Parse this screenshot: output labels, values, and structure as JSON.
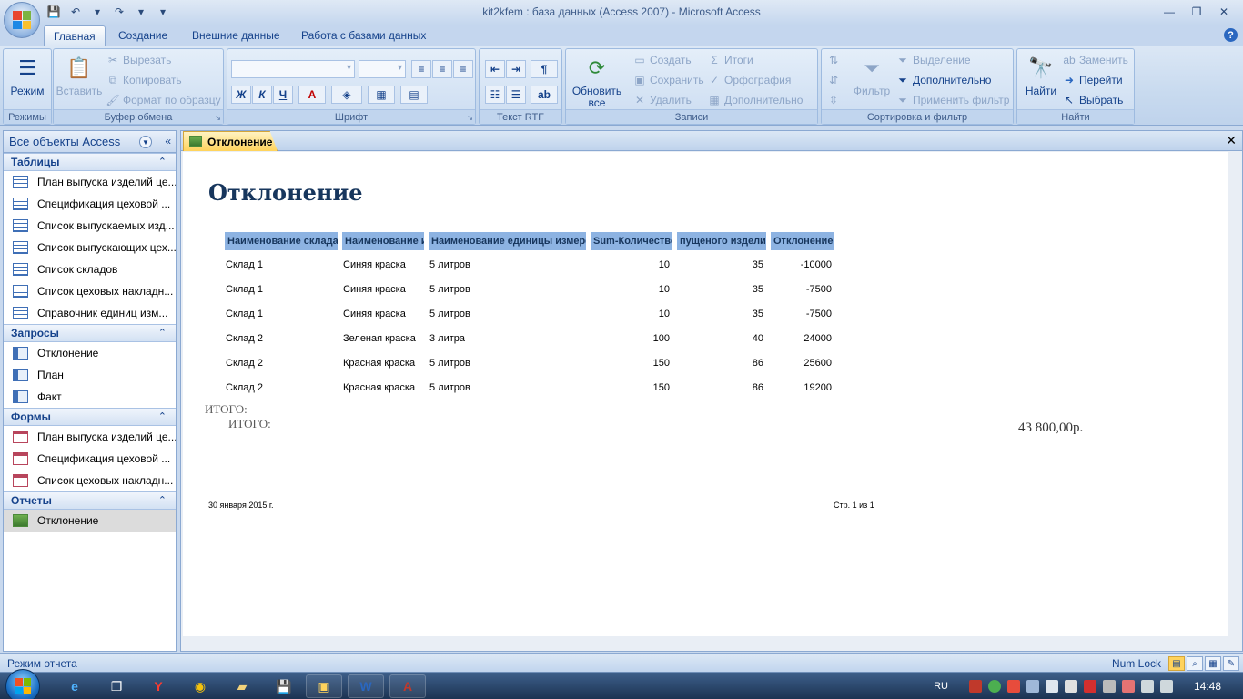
{
  "window": {
    "title": "kit2kfem : база данных (Access 2007) - Microsoft Access"
  },
  "ribbon_tabs": [
    "Главная",
    "Создание",
    "Внешние данные",
    "Работа с базами данных"
  ],
  "ribbon": {
    "views": {
      "label": "Режимы",
      "view_button": "Режим"
    },
    "clipboard": {
      "label": "Буфер обмена",
      "paste": "Вставить",
      "cut": "Вырезать",
      "copy": "Копировать",
      "format_painter": "Формат по образцу"
    },
    "font": {
      "label": "Шрифт",
      "bold": "Ж",
      "italic": "К",
      "underline": "Ч",
      "font_color": "А"
    },
    "rtf": {
      "label": "Текст RTF"
    },
    "records": {
      "label": "Записи",
      "refresh_line1": "Обновить",
      "refresh_line2": "все",
      "new": "Создать",
      "save": "Сохранить",
      "delete": "Удалить",
      "totals": "Итоги",
      "spelling": "Орфография",
      "more": "Дополнительно"
    },
    "sort_filter": {
      "label": "Сортировка и фильтр",
      "filter": "Фильтр",
      "selection": "Выделение",
      "advanced": "Дополнительно",
      "toggle_filter": "Применить фильтр"
    },
    "find": {
      "label": "Найти",
      "find": "Найти",
      "replace": "Заменить",
      "goto": "Перейти",
      "select": "Выбрать"
    }
  },
  "nav": {
    "header": "Все объекты Access",
    "groups": [
      {
        "title": "Таблицы",
        "type": "table",
        "items": [
          "План выпуска изделий це...",
          "Спецификация цеховой ...",
          "Список выпускаемых изд...",
          "Список выпускающих цех...",
          "Список складов",
          "Список цеховых накладн...",
          "Справочник единиц изм..."
        ]
      },
      {
        "title": "Запросы",
        "type": "query",
        "items": [
          "Отклонение",
          "План",
          "Факт"
        ]
      },
      {
        "title": "Формы",
        "type": "form",
        "items": [
          "План выпуска изделий це...",
          "Спецификация цеховой ...",
          "Список цеховых накладн..."
        ]
      },
      {
        "title": "Отчеты",
        "type": "report",
        "items": [
          "Отклонение"
        ]
      }
    ]
  },
  "document": {
    "tab_title": "Отклонение",
    "report": {
      "title": "Отклонение",
      "columns": [
        "Наименование склада",
        "Наименование и",
        "Наименование единицы измере",
        "Sum-Количество",
        "пущеного изделия",
        "Отклонение"
      ],
      "rows": [
        [
          "Склад 1",
          "Синяя краска",
          "5 литров",
          "10",
          "35",
          "-10000"
        ],
        [
          "Склад 1",
          "Синяя краска",
          "5 литров",
          "10",
          "35",
          "-7500"
        ],
        [
          "Склад 1",
          "Синяя краска",
          "5 литров",
          "10",
          "35",
          "-7500"
        ],
        [
          "Склад 2",
          "Зеленая краска",
          "3 литра",
          "100",
          "40",
          "24000"
        ],
        [
          "Склад 2",
          "Красная краска",
          "5 литров",
          "150",
          "86",
          "25600"
        ],
        [
          "Склад 2",
          "Красная краска",
          "5 литров",
          "150",
          "86",
          "19200"
        ]
      ],
      "total_label_1": "ИТОГО:",
      "total_label_2": "ИТОГО:",
      "total_value": "43 800,00р.",
      "footer_date": "30 января 2015 г.",
      "footer_page": "Стр. 1 из 1"
    }
  },
  "status": {
    "mode": "Режим отчета",
    "numlock": "Num Lock"
  },
  "taskbar": {
    "lang": "RU",
    "time": "14:48"
  }
}
